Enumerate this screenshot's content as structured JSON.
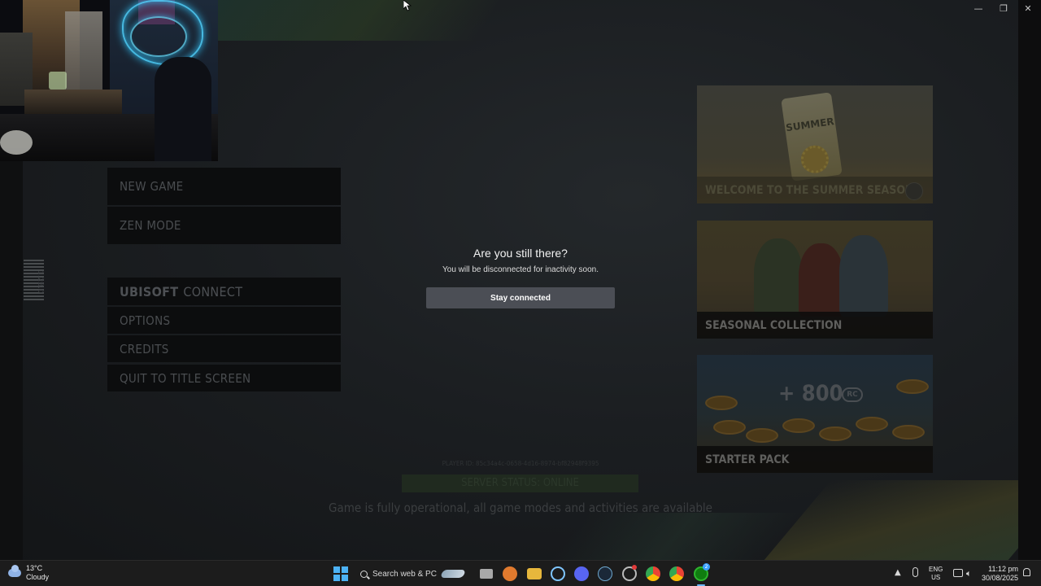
{
  "window": {
    "minimize": "—",
    "restore": "❐",
    "close": "✕"
  },
  "menu": {
    "new_game": "NEW GAME",
    "zen_mode": "ZEN MODE",
    "ubisoft_bold": "UBISOFT",
    "ubisoft_rest": "CONNECT",
    "options": "OPTIONS",
    "credits": "CREDITS",
    "quit": "QUIT TO TITLE SCREEN"
  },
  "side": {
    "version": "1.28.0"
  },
  "cards": [
    {
      "caption": "WELCOME TO THE SUMMER SEASON!",
      "badge_text": "SUMMER"
    },
    {
      "caption": "SEASONAL COLLECTION"
    },
    {
      "caption": "STARTER PACK",
      "amount": "+ 800",
      "currency": "RC"
    }
  ],
  "footer": {
    "player_id": "PLAYER ID: 85c34a4c-0658-4d16-8974-bf82948f9395",
    "server_status": "SERVER STATUS: ONLINE",
    "server_message": "Game is fully operational, all game modes and activities are available"
  },
  "dialog": {
    "title": "Are you still there?",
    "message": "You will be disconnected for inactivity soon.",
    "button": "Stay connected"
  },
  "taskbar": {
    "weather_temp": "13°C",
    "weather_desc": "Cloudy",
    "search_placeholder": "Search web & PC",
    "lang_top": "ENG",
    "lang_bottom": "US",
    "time": "11:12 pm",
    "date": "30/08/2025",
    "xbox_badge": "2"
  },
  "colors": {
    "accent": "#4b4e55",
    "taskbar": "#1c1c1c",
    "start": "#4cb2f5"
  }
}
